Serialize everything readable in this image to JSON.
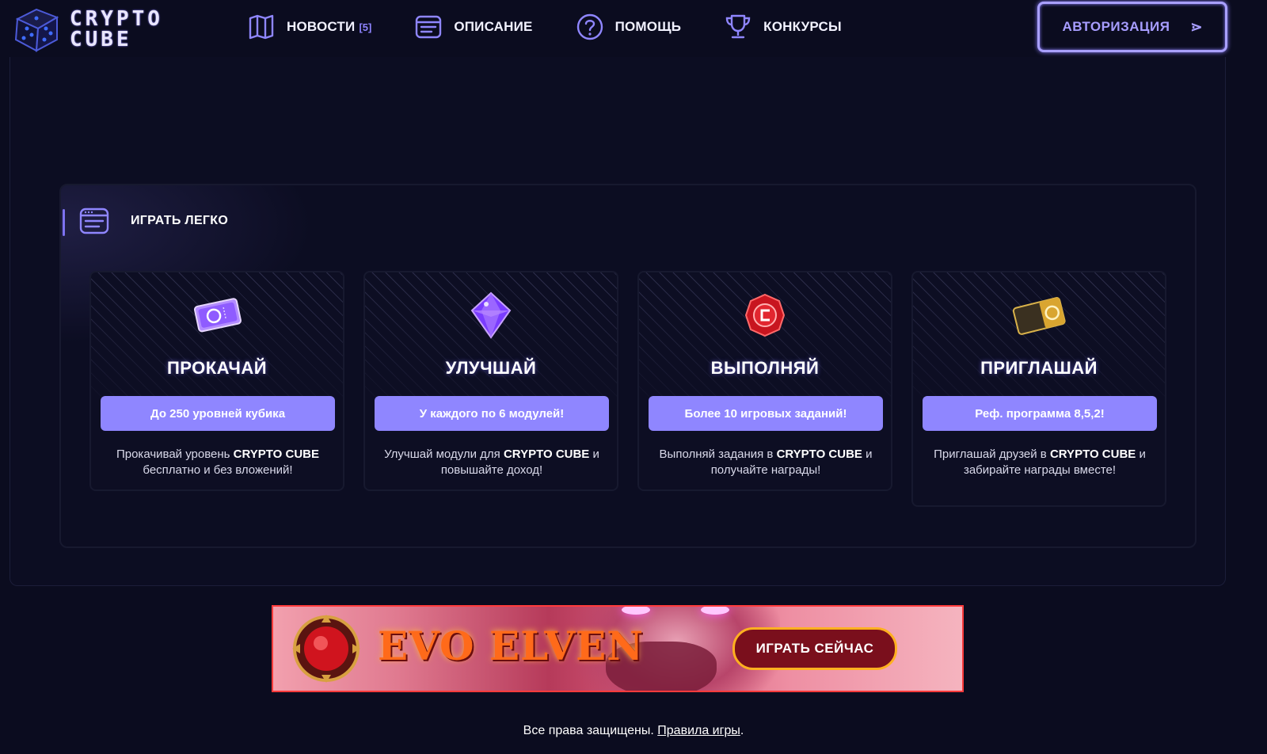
{
  "brand": {
    "line1": "CRYPTO",
    "line2": "CUBE"
  },
  "nav": {
    "items": [
      {
        "label": "НОВОСТИ",
        "badge": "[5]",
        "icon": "map-icon"
      },
      {
        "label": "ОПИСАНИЕ",
        "icon": "document-list-icon"
      },
      {
        "label": "ПОМОЩЬ",
        "icon": "help-circle-icon"
      },
      {
        "label": "КОНКУРСЫ",
        "icon": "trophy-icon"
      }
    ],
    "auth_label": "АВТОРИЗАЦИЯ",
    "auth_arrow": "⋗"
  },
  "section": {
    "title": "ИГРАТЬ ЛЕГКО",
    "icon": "browser-window-icon"
  },
  "cards": [
    {
      "title": "ПРОКАЧАЙ",
      "button": "До 250 уровней кубика",
      "desc_before": "Прокачивай уровень ",
      "desc_bold": "CRYPTO CUBE",
      "desc_after": " бесплатно и без вложений!",
      "icon": "ticket-icon"
    },
    {
      "title": "УЛУЧШАЙ",
      "button": "У каждого по 6 модулей!",
      "desc_before": "Улучшай модули для ",
      "desc_bold": "CRYPTO CUBE",
      "desc_after": " и повышайте доход!",
      "icon": "purple-crystal-icon"
    },
    {
      "title": "ВЫПОЛНЯЙ",
      "button": "Более 10 игровых заданий!",
      "desc_before": "Выполняй задания в ",
      "desc_bold": "CRYPTO CUBE",
      "desc_after": " и получайте награды!",
      "icon": "red-token-icon"
    },
    {
      "title": "ПРИГЛАШАЙ",
      "button": "Реф. программа 8,5,2!",
      "desc_before": "Приглашай друзей в ",
      "desc_bold": "CRYPTO CUBE",
      "desc_after": " и забирайте награды вместе!",
      "icon": "gold-card-icon"
    }
  ],
  "banner": {
    "logo": "EVO ELVEN",
    "button": "ИГРАТЬ СЕЙЧАС"
  },
  "footer": {
    "text": "Все права защищены.",
    "link": "Правила игры",
    "end": "."
  },
  "colors": {
    "background": "#0b0c1f",
    "accent": "#8f86ff",
    "card_border": "#17192f",
    "banner_border": "#ff3b3b"
  }
}
